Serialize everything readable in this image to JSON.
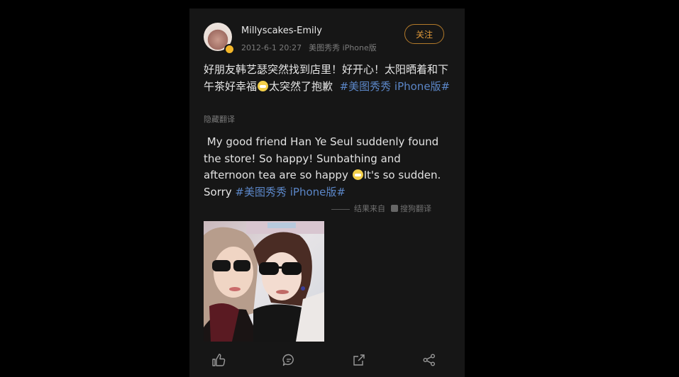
{
  "post": {
    "username": "Millyscakes-Emily",
    "timestamp": "2012-6-1 20:27",
    "source": "美图秀秀 iPhone版",
    "follow_label": "关注",
    "text_part1": "好朋友韩艺瑟突然找到店里！好开心！太阳晒着和下午茶好幸福",
    "text_part2": "太突然了抱歉",
    "text_hashtag": "#美图秀秀 iPhone版#",
    "hide_translation_label": "隐藏翻译",
    "translation_part1": "My good friend Han Ye Seul suddenly found the store! So happy! Sunbathing and afternoon tea are so happy ",
    "translation_part2": "It's so sudden. Sorry ",
    "translation_hashtag": "#美图秀秀 iPhone版#",
    "translation_source_prefix": "结果来自",
    "translation_source_name": "搜狗翻译"
  },
  "actions": {
    "like_icon": "thumbs-up-icon",
    "comment_icon": "comment-icon",
    "repost_icon": "repost-icon",
    "share_icon": "share-icon"
  },
  "colors": {
    "background": "#000000",
    "card": "#161616",
    "hashtag": "#5b86c7",
    "follow": "#e09a3a",
    "badge": "#f3b629"
  }
}
